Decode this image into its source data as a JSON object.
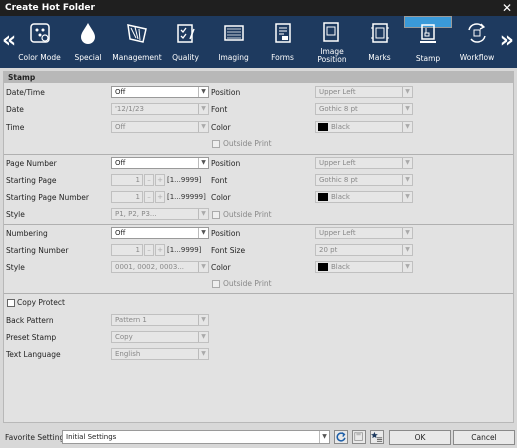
{
  "window": {
    "title": "Create Hot Folder",
    "close_glyph": "✕"
  },
  "nav": {
    "left_glyph": "«",
    "right_glyph": "»"
  },
  "tabs": [
    {
      "label": "Color Mode",
      "icon": "color-mode-icon"
    },
    {
      "label": "Special",
      "icon": "drop-icon"
    },
    {
      "label": "Management",
      "icon": "management-icon"
    },
    {
      "label": "Quality",
      "icon": "quality-icon"
    },
    {
      "label": "Imaging",
      "icon": "imaging-icon"
    },
    {
      "label": "Forms",
      "icon": "forms-icon"
    },
    {
      "label": "Image Position",
      "icon": "image-position-icon"
    },
    {
      "label": "Marks",
      "icon": "marks-icon"
    },
    {
      "label": "Stamp",
      "icon": "stamp-icon",
      "selected": true
    },
    {
      "label": "Workflow",
      "icon": "workflow-icon"
    }
  ],
  "section_title": "Stamp",
  "datetime": {
    "label": "Date/Time",
    "value": "Off",
    "date_label": "Date",
    "date_value": "'12/1/23",
    "time_label": "Time",
    "time_value": "Off",
    "position_label": "Position",
    "position_value": "Upper Left",
    "font_label": "Font",
    "font_value": "Gothic 8 pt",
    "color_label": "Color",
    "color_value": "Black",
    "outside_print": "Outside Print"
  },
  "page_number": {
    "label": "Page Number",
    "value": "Off",
    "starting_page_label": "Starting Page",
    "starting_page_value": "1",
    "starting_page_range": "[1...9999]",
    "starting_page_number_label": "Starting Page Number",
    "starting_page_number_value": "1",
    "starting_page_number_range": "[1...99999]",
    "style_label": "Style",
    "style_value": "P1, P2, P3...",
    "position_label": "Position",
    "position_value": "Upper Left",
    "font_label": "Font",
    "font_value": "Gothic 8 pt",
    "color_label": "Color",
    "color_value": "Black",
    "outside_print": "Outside Print"
  },
  "numbering": {
    "label": "Numbering",
    "value": "Off",
    "starting_number_label": "Starting Number",
    "starting_number_value": "1",
    "starting_number_range": "[1...9999]",
    "style_label": "Style",
    "style_value": "0001, 0002, 0003...",
    "position_label": "Position",
    "position_value": "Upper Left",
    "font_size_label": "Font Size",
    "font_size_value": "20 pt",
    "color_label": "Color",
    "color_value": "Black",
    "outside_print": "Outside Print"
  },
  "copy_protect": {
    "label": "Copy Protect",
    "back_pattern_label": "Back Pattern",
    "back_pattern_value": "Pattern 1",
    "preset_stamp_label": "Preset Stamp",
    "preset_stamp_value": "Copy",
    "text_language_label": "Text Language",
    "text_language_value": "English"
  },
  "spin": {
    "minus": "–",
    "plus": "+"
  },
  "dropdown_glyph": "▼",
  "footer": {
    "favorite_label": "Favorite Setting",
    "favorite_value": "Initial Settings",
    "ok": "OK",
    "cancel": "Cancel"
  },
  "colors": {
    "titlebar": "#1f1f1f",
    "tabbar": "#1e3a5f",
    "tab_selected": "#3a9ad9",
    "panel": "#e2e2e2"
  }
}
